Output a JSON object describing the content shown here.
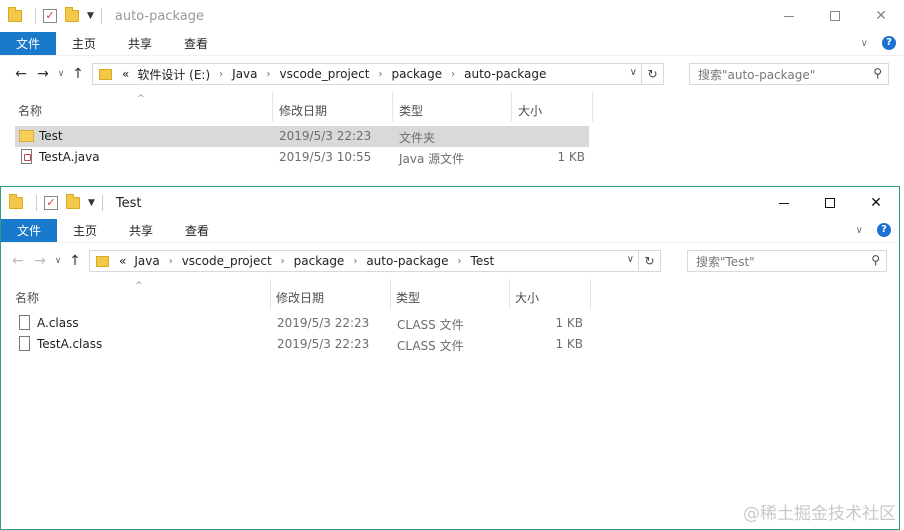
{
  "window1": {
    "title": "auto-package",
    "ribbon": {
      "file": "文件",
      "home": "主页",
      "share": "共享",
      "view": "查看"
    },
    "breadcrumb": [
      "软件设计 (E:)",
      "Java",
      "vscode_project",
      "package",
      "auto-package"
    ],
    "search_placeholder": "搜索\"auto-package\"",
    "columns": {
      "name": "名称",
      "date": "修改日期",
      "type": "类型",
      "size": "大小"
    },
    "files": [
      {
        "name": "Test",
        "date": "2019/5/3 22:23",
        "type": "文件夹",
        "size": "",
        "icon": "folder-icon",
        "selected": true
      },
      {
        "name": "TestA.java",
        "date": "2019/5/3 10:55",
        "type": "Java 源文件",
        "size": "1 KB",
        "icon": "java-file-icon",
        "selected": false
      }
    ]
  },
  "window2": {
    "title": "Test",
    "ribbon": {
      "file": "文件",
      "home": "主页",
      "share": "共享",
      "view": "查看"
    },
    "overflow": "«",
    "breadcrumb": [
      "Java",
      "vscode_project",
      "package",
      "auto-package",
      "Test"
    ],
    "search_placeholder": "搜索\"Test\"",
    "columns": {
      "name": "名称",
      "date": "修改日期",
      "type": "类型",
      "size": "大小"
    },
    "files": [
      {
        "name": "A.class",
        "date": "2019/5/3 22:23",
        "type": "CLASS 文件",
        "size": "1 KB",
        "icon": "class-file-icon"
      },
      {
        "name": "TestA.class",
        "date": "2019/5/3 22:23",
        "type": "CLASS 文件",
        "size": "1 KB",
        "icon": "class-file-icon"
      }
    ]
  },
  "window1_overflow": "«",
  "watermark": "@稀土掘金技术社区",
  "colors": {
    "accent": "#1979ca",
    "folder": "#f5cd5a",
    "selected_row": "#d9d9d9"
  }
}
